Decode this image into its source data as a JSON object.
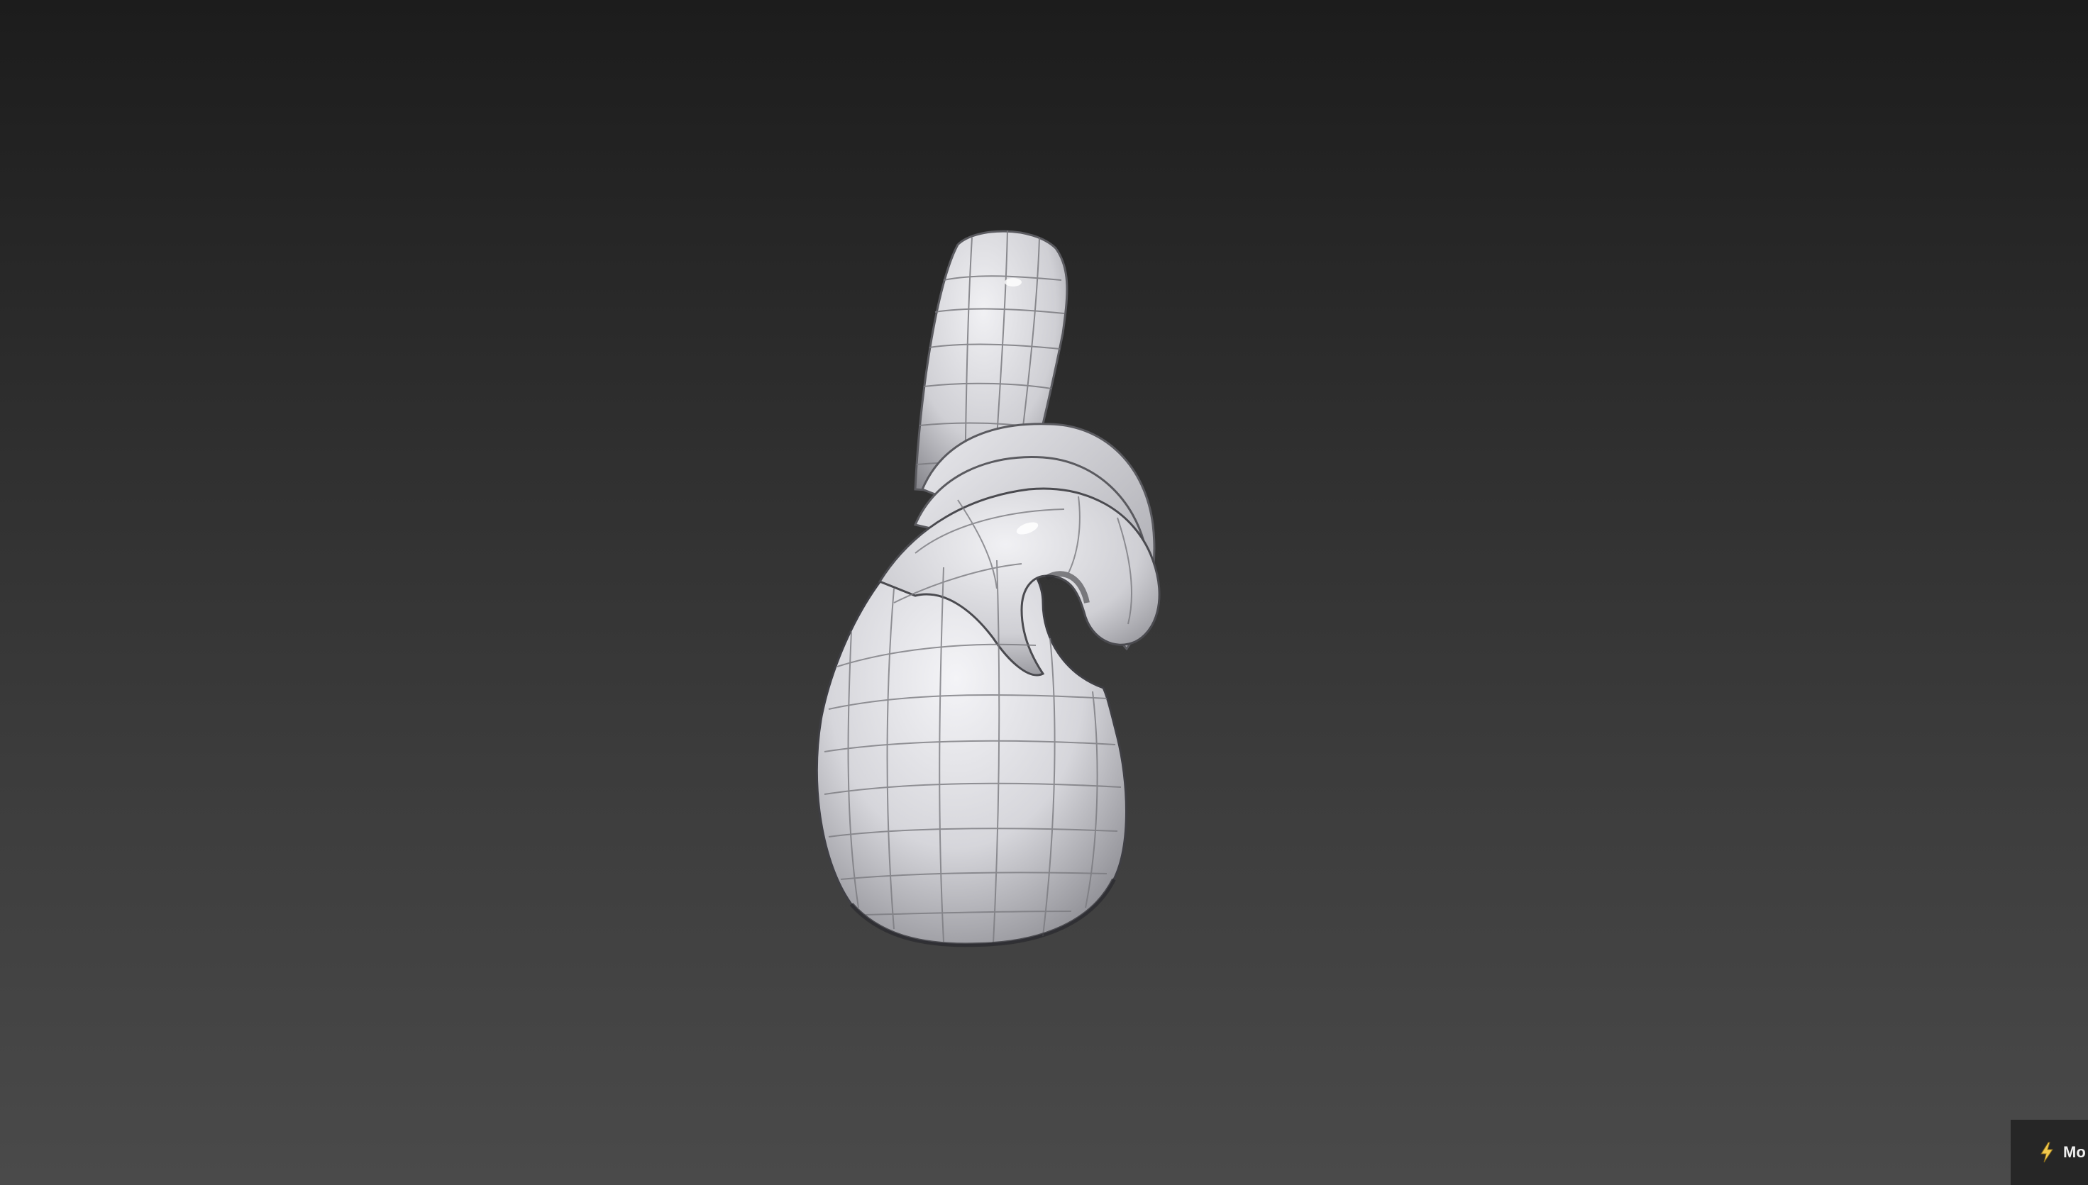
{
  "viewport": {
    "background_top": "#1c1c1c",
    "background_bottom": "#4a4a4a",
    "model": {
      "name": "hand-pointing-up",
      "shading": "smooth-with-wireframe",
      "surface_color": "#d9d9de",
      "wire_color": "#7a7a7f"
    }
  },
  "corner_chip": {
    "icon": "lightning-bolt-icon",
    "icon_color": "#f2c94c",
    "label": "Mo"
  }
}
